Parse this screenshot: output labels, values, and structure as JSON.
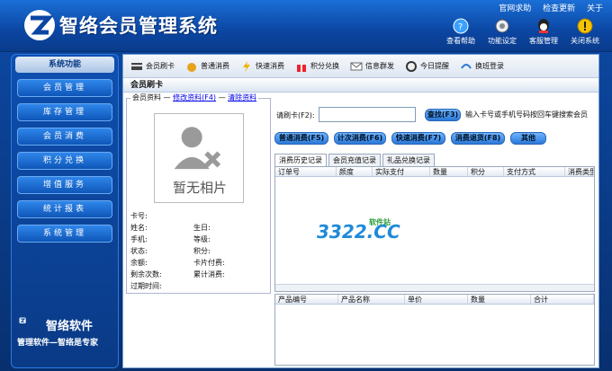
{
  "app": {
    "title": "智络会员管理系统"
  },
  "top_links": [
    "官网求助",
    "检查更新",
    "关于"
  ],
  "top_tools": [
    {
      "label": "查看帮助",
      "icon": "help-icon"
    },
    {
      "label": "功能设定",
      "icon": "settings-icon"
    },
    {
      "label": "客服管理",
      "icon": "support-icon"
    },
    {
      "label": "关闭系统",
      "icon": "close-system-icon"
    }
  ],
  "sidebar": {
    "header": "系统功能",
    "items": [
      "会员管理",
      "库存管理",
      "会员消费",
      "积分兑换",
      "增值服务",
      "统计报表",
      "系统管理"
    ]
  },
  "brand": {
    "name": "智络软件",
    "tagline": "管理软件—智络是专家"
  },
  "toolbar": [
    "会员刷卡",
    "普通消费",
    "快速消费",
    "积分兑换",
    "信息群发",
    "今日提醒",
    "换班登录"
  ],
  "section_title": "会员刷卡",
  "member_panel": {
    "legend": "会员资料",
    "edit_link": "修改资料(F4)",
    "clear_link": "清除资料",
    "photo_text": "暂无相片",
    "fields": [
      "卡号:",
      "姓名:",
      "生日:",
      "手机:",
      "等级:",
      "状态:",
      "积分:",
      "余额:",
      "卡片付费:",
      "剩余次数:",
      "累计消费:",
      "过期时间:"
    ]
  },
  "swipe": {
    "label": "请刷卡(F2):",
    "value": "",
    "search_button": "查找(F3)",
    "hint": "输入卡号或手机号码按回车键搜索会员"
  },
  "actions": [
    "普通消费(F5)",
    "计次消费(F6)",
    "快速消费(F7)",
    "消费退货(F8)",
    "其他"
  ],
  "tabs": [
    "消费历史记录",
    "会员充值记录",
    "礼品兑换记录"
  ],
  "history_columns": [
    "订单号",
    "颜度",
    "实际支付",
    "数量",
    "积分",
    "支付方式",
    "消费类型"
  ],
  "product_columns": [
    "产品编号",
    "产品名称",
    "单价",
    "数量",
    "合计"
  ],
  "watermark": {
    "text": "3322.CC",
    "sub": "软件站"
  }
}
